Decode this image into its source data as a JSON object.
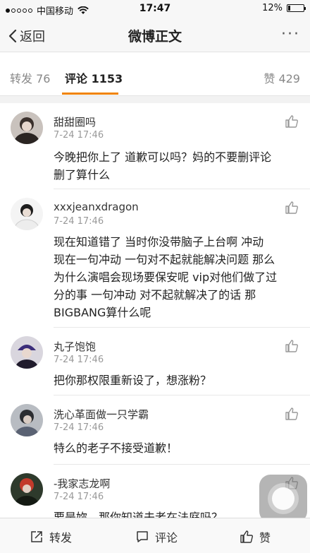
{
  "status_bar": {
    "carrier": "中国移动",
    "time": "17:47",
    "battery": "12%",
    "battery_level": 0.12
  },
  "nav": {
    "back_label": "返回",
    "title": "微博正文",
    "more_label": "···"
  },
  "tabs": {
    "repost": "转发 76",
    "comments": "评论 1153",
    "likes": "赞 429"
  },
  "comments": [
    {
      "name": "甜甜圈吗",
      "time": "7-24 17:46",
      "lines": [
        "今晚把你上了 道歉可以吗？妈的不要删评论",
        "删了算什么"
      ]
    },
    {
      "name": "xxxjeanxdragon",
      "time": "7-24 17:46",
      "lines": [
        "现在知道错了 当时你没带脑子上台啊 冲动",
        "现在一句冲动 一句对不起就能解决问题 那么",
        "为什么演唱会现场要保安呢 vip对他们做了过",
        "分的事 一句冲动 对不起就解决了的话 那",
        "BIGBANG算什么呢"
      ]
    },
    {
      "name": "丸子饱饱",
      "time": "7-24 17:46",
      "lines": [
        "把你那权限重新设了，想涨粉？"
      ]
    },
    {
      "name": "洗心革面做一只学霸",
      "time": "7-24 17:46",
      "lines": [
        "特么的老子不接受道歉！"
      ]
    },
    {
      "name": "-我家志龙啊",
      "time": "7-24 17:46",
      "lines": [
        "要是妳，那你知道夫老在法庭吗？"
      ]
    }
  ],
  "bottom_bar": {
    "repost": "转发",
    "comment": "评论",
    "like": "赞"
  },
  "colors": {
    "accent": "#f08300",
    "text": "#222222",
    "muted": "#999999"
  }
}
